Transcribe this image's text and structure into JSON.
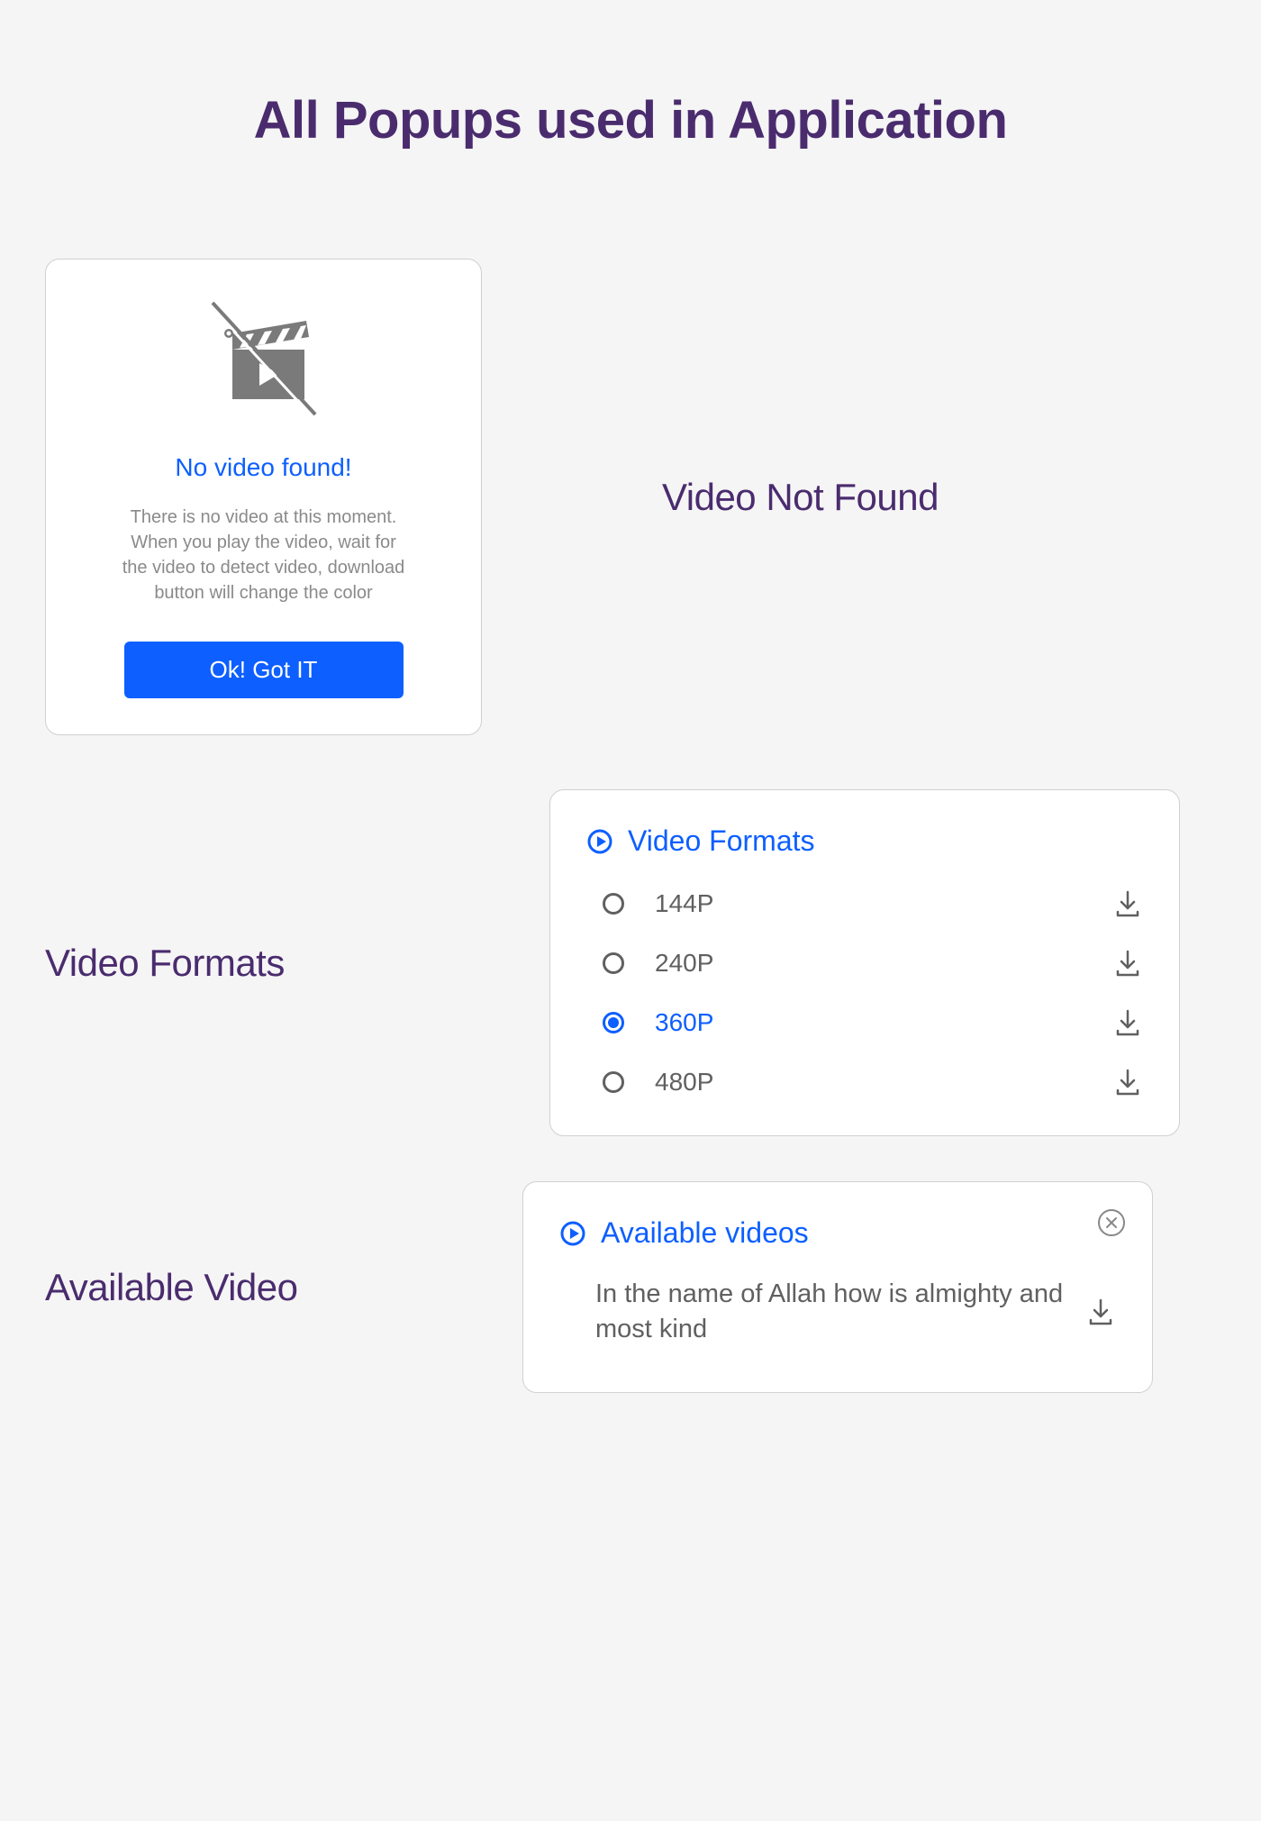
{
  "page_title": "All Popups used in Application",
  "sections": {
    "video_not_found_label": "Video Not Found",
    "video_formats_label": "Video Formats",
    "available_video_label": "Available Video"
  },
  "no_video_popup": {
    "title": "No video found!",
    "description": "There is no video at this moment. When you play the video, wait for the video to detect video, download button will change the color",
    "button_label": "Ok! Got IT"
  },
  "video_formats_popup": {
    "header": "Video Formats",
    "options": [
      {
        "label": "144P",
        "selected": false
      },
      {
        "label": "240P",
        "selected": false
      },
      {
        "label": "360P",
        "selected": true
      },
      {
        "label": "480P",
        "selected": false
      }
    ]
  },
  "available_videos_popup": {
    "header": "Available videos",
    "items": [
      {
        "title": "In the name of Allah how is almighty and most kind"
      }
    ]
  }
}
